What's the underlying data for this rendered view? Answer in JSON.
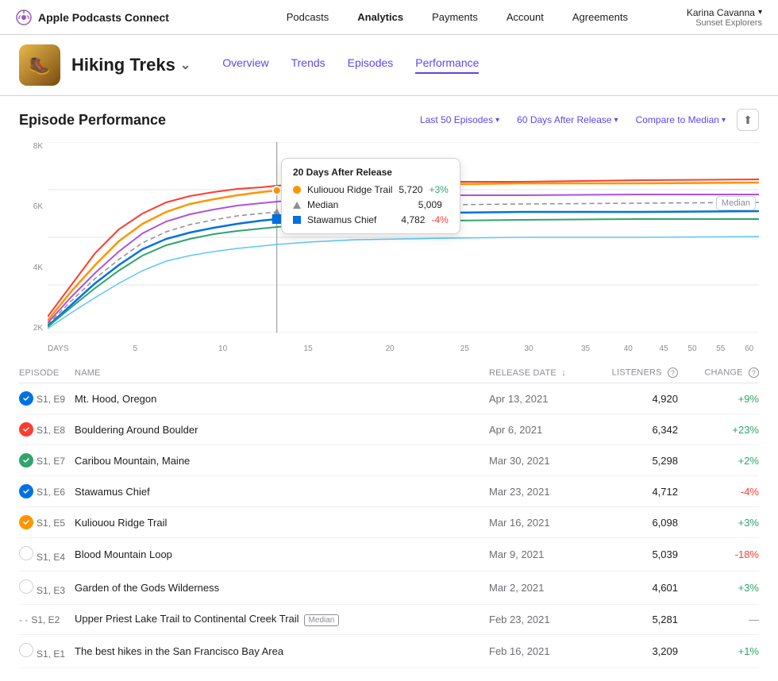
{
  "brand": {
    "name": "Apple Podcasts Connect",
    "icon": "podcast-icon"
  },
  "nav": {
    "links": [
      {
        "label": "Podcasts",
        "active": false
      },
      {
        "label": "Analytics",
        "active": true
      },
      {
        "label": "Payments",
        "active": false
      },
      {
        "label": "Account",
        "active": false
      },
      {
        "label": "Agreements",
        "active": false
      }
    ]
  },
  "user": {
    "name": "Karina Cavanna",
    "subtitle": "Sunset Explorers"
  },
  "podcast": {
    "title": "Hiking Treks",
    "tabs": [
      {
        "label": "Overview",
        "active": false
      },
      {
        "label": "Trends",
        "active": false
      },
      {
        "label": "Episodes",
        "active": false
      },
      {
        "label": "Performance",
        "active": true
      }
    ]
  },
  "section": {
    "title": "Episode Performance",
    "filters": {
      "episodes": "Last 50 Episodes",
      "days": "60 Days After Release",
      "compare": "Compare to Median"
    }
  },
  "chart": {
    "y_labels": [
      "8K",
      "6K",
      "4K",
      "2K"
    ],
    "x_labels": [
      "DAYS",
      "5",
      "10",
      "15",
      "20",
      "25",
      "30",
      "35",
      "40",
      "45",
      "50",
      "55",
      "60"
    ],
    "median_label": "Median",
    "tooltip": {
      "header": "20 Days After Release",
      "rows": [
        {
          "type": "dot",
          "color": "#ff9500",
          "name": "Kuliouou Ridge Trail",
          "value": "5,720",
          "change": "+3%",
          "pos": true
        },
        {
          "type": "tri",
          "color": "#8e8e93",
          "name": "Median",
          "value": "5,009",
          "change": "",
          "pos": null
        },
        {
          "type": "sq",
          "color": "#0071e3",
          "name": "Stawamus Chief",
          "value": "4,782",
          "change": "-4%",
          "pos": false
        }
      ]
    }
  },
  "table": {
    "headers": [
      "EPISODE",
      "NAME",
      "RELEASE DATE",
      "LISTENERS",
      "CHANGE"
    ],
    "rows": [
      {
        "status": "blue",
        "ep": "S1, E9",
        "name": "Mt. Hood, Oregon",
        "date": "Apr 13, 2021",
        "listeners": "4,920",
        "change": "+9%",
        "pos": true,
        "median": false
      },
      {
        "status": "red",
        "ep": "S1, E8",
        "name": "Bouldering Around Boulder",
        "date": "Apr 6, 2021",
        "listeners": "6,342",
        "change": "+23%",
        "pos": true,
        "median": false
      },
      {
        "status": "green",
        "ep": "S1, E7",
        "name": "Caribou Mountain, Maine",
        "date": "Mar 30, 2021",
        "listeners": "5,298",
        "change": "+2%",
        "pos": true,
        "median": false
      },
      {
        "status": "blue",
        "ep": "S1, E6",
        "name": "Stawamus Chief",
        "date": "Mar 23, 2021",
        "listeners": "4,712",
        "change": "-4%",
        "pos": false,
        "median": false
      },
      {
        "status": "orange",
        "ep": "S1, E5",
        "name": "Kuliouou Ridge Trail",
        "date": "Mar 16, 2021",
        "listeners": "6,098",
        "change": "+3%",
        "pos": true,
        "median": false
      },
      {
        "status": "empty",
        "ep": "S1, E4",
        "name": "Blood Mountain Loop",
        "date": "Mar 9, 2021",
        "listeners": "5,039",
        "change": "-18%",
        "pos": false,
        "median": false
      },
      {
        "status": "empty",
        "ep": "S1, E3",
        "name": "Garden of the Gods Wilderness",
        "date": "Mar 2, 2021",
        "listeners": "4,601",
        "change": "+3%",
        "pos": true,
        "median": false
      },
      {
        "status": "dash",
        "ep": "S1, E2",
        "name": "Upper Priest Lake Trail to Continental Creek Trail",
        "date": "Feb 23, 2021",
        "listeners": "5,281",
        "change": "—",
        "pos": null,
        "median": true
      },
      {
        "status": "empty",
        "ep": "S1, E1",
        "name": "The best hikes in the San Francisco Bay Area",
        "date": "Feb 16, 2021",
        "listeners": "3,209",
        "change": "+1%",
        "pos": true,
        "median": false
      }
    ]
  }
}
